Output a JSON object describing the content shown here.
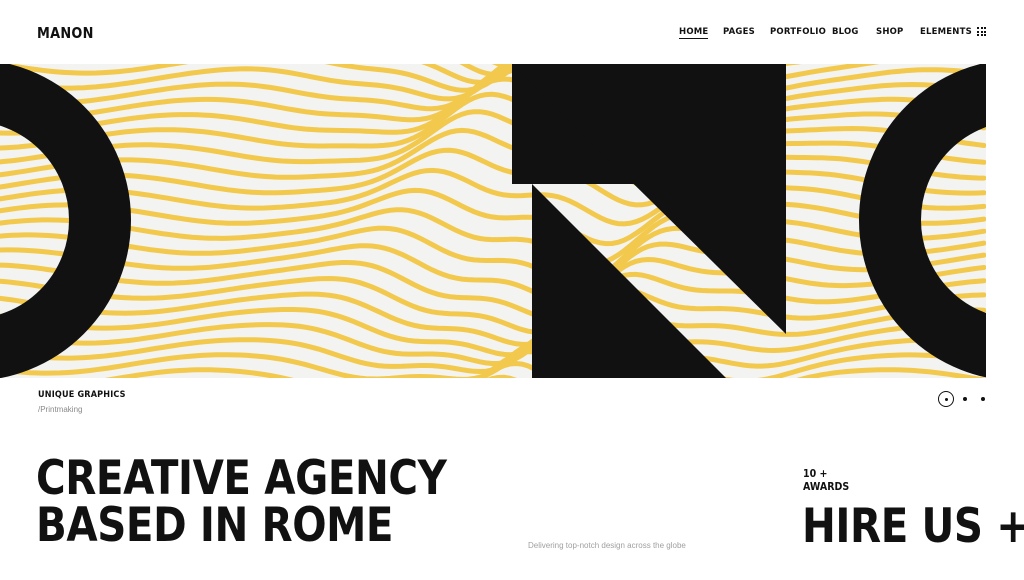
{
  "header": {
    "logo": "MANON",
    "nav": [
      "HOME",
      "PAGES",
      "PORTFOLIO",
      "BLOG",
      "SHOP",
      "ELEMENTS"
    ],
    "active_nav": "HOME",
    "menu_icon": "grid-menu-icon"
  },
  "hero": {
    "artwork_colors": {
      "background": "#f3f3f1",
      "stripes": "#f2c94c",
      "shapes": "#111111"
    },
    "slider": {
      "total_slides": 3,
      "active_slide": 1
    }
  },
  "caption": {
    "title": "UNIQUE GRAPHICS",
    "subtitle": "/Printmaking"
  },
  "footer_section": {
    "headline_line1": "CREATIVE AGENCY",
    "headline_line2": "BASED IN ROME",
    "tagline": "Delivering top-notch design across the globe",
    "awards_line1": "10 +",
    "awards_line2": "AWARDS",
    "cta": "HIRE US +"
  }
}
